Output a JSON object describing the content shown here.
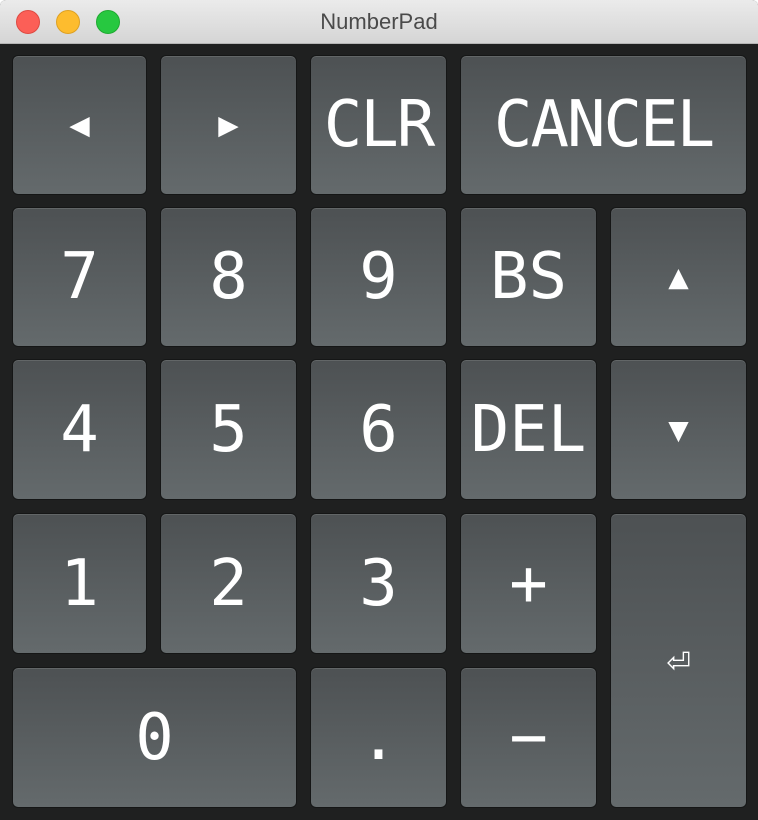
{
  "window": {
    "title": "NumberPad"
  },
  "keys": {
    "left": "◀",
    "right": "▶",
    "clr": "CLR",
    "cancel": "CANCEL",
    "seven": "7",
    "eight": "8",
    "nine": "9",
    "bs": "BS",
    "up": "▲",
    "four": "4",
    "five": "5",
    "six": "6",
    "del": "DEL",
    "down": "▼",
    "one": "1",
    "two": "2",
    "three": "3",
    "plus": "+",
    "enter": "⏎",
    "zero": "0",
    "dot": ".",
    "minus": "−"
  },
  "icons": {
    "left": "left-arrow-icon",
    "right": "right-arrow-icon",
    "up": "up-arrow-icon",
    "down": "down-arrow-icon",
    "enter": "return-icon"
  },
  "colors": {
    "key_top": "#4d5153",
    "key_bottom": "#646a6c",
    "background": "#1f2020",
    "label": "#ffffff"
  }
}
